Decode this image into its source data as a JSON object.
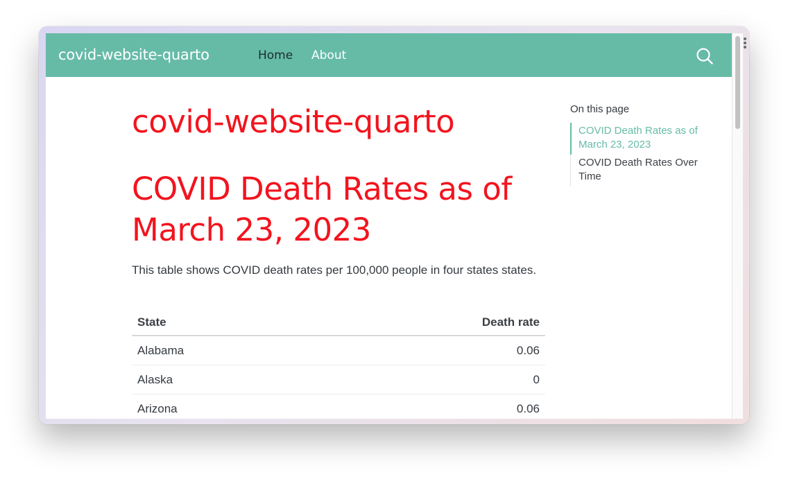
{
  "navbar": {
    "brand": "covid-website-quarto",
    "links": [
      "Home",
      "About"
    ],
    "search_icon": "search-icon",
    "background": "#66bba7"
  },
  "main": {
    "title": "covid-website-quarto",
    "section_title": "COVID Death Rates as of March 23, 2023",
    "intro": "This table shows COVID death rates per 100,000 people in four states states.",
    "title_color": "#f2141e",
    "table": {
      "headers": [
        "State",
        "Death rate"
      ],
      "rows": [
        [
          "Alabama",
          "0.06"
        ],
        [
          "Alaska",
          "0"
        ],
        [
          "Arizona",
          "0.06"
        ]
      ]
    }
  },
  "toc": {
    "heading": "On this page",
    "items": [
      "COVID Death Rates as of March 23, 2023",
      "COVID Death Rates Over Time"
    ],
    "active_index": 0
  }
}
